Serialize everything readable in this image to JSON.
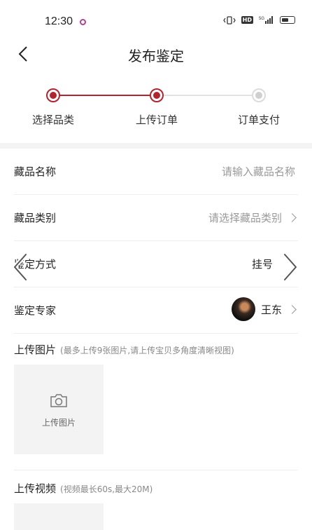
{
  "status_bar": {
    "time": "12:30",
    "network": "5G",
    "hd": "HD"
  },
  "nav": {
    "title": "发布鉴定"
  },
  "steps": [
    {
      "label": "选择品类",
      "state": "done"
    },
    {
      "label": "上传订单",
      "state": "active"
    },
    {
      "label": "订单支付",
      "state": "pending"
    }
  ],
  "colors": {
    "accent": "#b3242e",
    "pending": "#cccccc"
  },
  "form": {
    "name": {
      "label": "藏品名称",
      "placeholder": "请输入藏品名称"
    },
    "category": {
      "label": "藏品类别",
      "placeholder": "请选择藏品类别"
    },
    "method": {
      "label": "鉴定方式",
      "value": "挂号"
    },
    "expert": {
      "label": "鉴定专家",
      "value": "王东"
    }
  },
  "upload_images": {
    "title": "上传图片",
    "hint": "(最多上传9张图片,请上传宝贝多角度清晰视图)",
    "button_label": "上传图片"
  },
  "upload_video": {
    "title": "上传视频",
    "hint": "(视频最长60s,最大20M)"
  },
  "icons": {
    "back": "chevron-left-icon",
    "camera": "camera-icon",
    "chevron": "chevron-right-icon"
  }
}
